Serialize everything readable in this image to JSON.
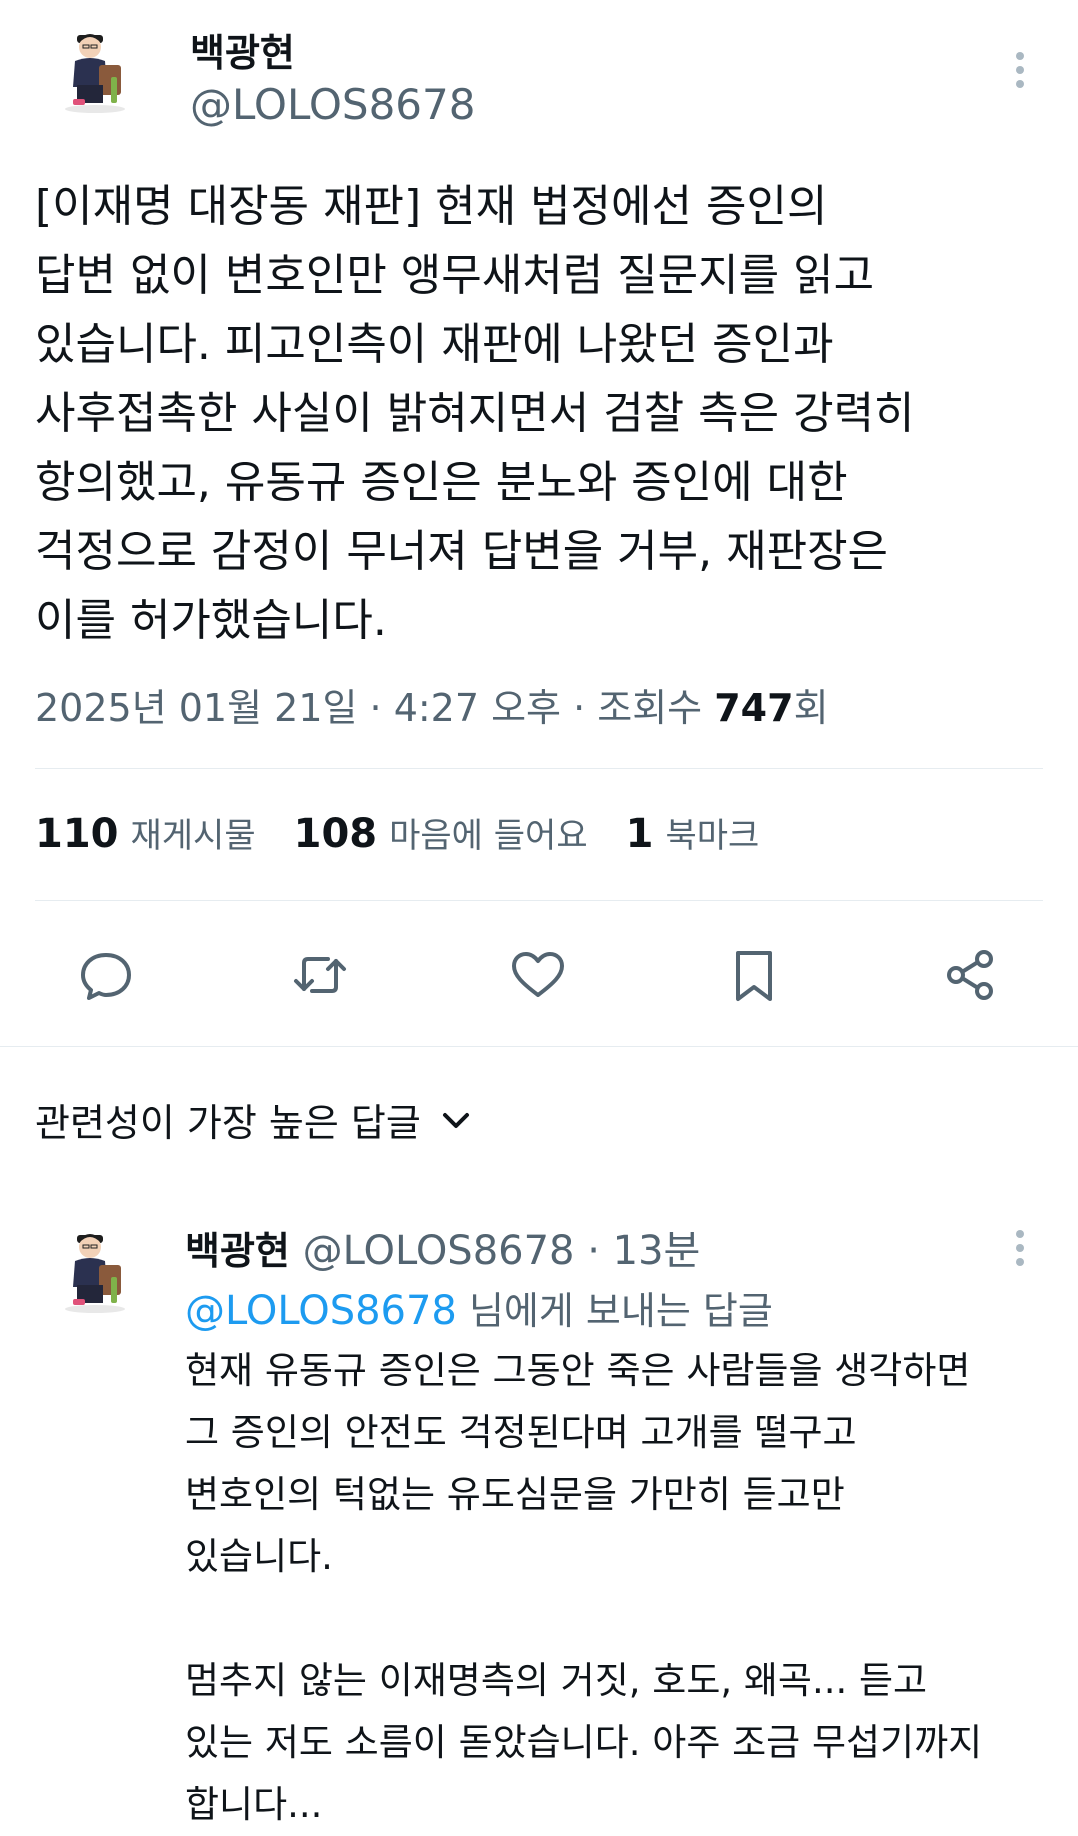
{
  "tweet": {
    "author_name": "백광현",
    "author_handle": "@LOLOS8678",
    "text_lines": [
      "[이재명 대장동 재판] 현재 법정에선 증인의",
      "답변 없이 변호인만 앵무새처럼 질문지를 읽고",
      "있습니다. 피고인측이 재판에 나왔던 증인과",
      "사후접촉한 사실이 밝혀지면서 검찰 측은 강력히",
      "항의했고, 유동규 증인은 분노와 증인에 대한",
      "걱정으로 감정이 무너져 답변을 거부, 재판장은",
      "이를 허가했습니다."
    ],
    "timestamp": "2025년 01월 21일 · 4:27 오후 · 조회수",
    "views_count": "747",
    "views_suffix": "회"
  },
  "stats": {
    "reposts_count": "110",
    "reposts_label": "재게시물",
    "likes_count": "108",
    "likes_label": "마음에 들어요",
    "bookmarks_count": "1",
    "bookmarks_label": "북마크"
  },
  "icons": {
    "reply": "reply-bubble-icon",
    "repost": "repost-arrows-icon",
    "like": "heart-icon",
    "bookmark": "bookmark-icon",
    "share": "share-icon",
    "more": "more-vertical-icon",
    "chevron": "chevron-down-icon"
  },
  "sort": {
    "label": "관련성이 가장 높은 답글"
  },
  "reply": {
    "author_name": "백광현",
    "author_handle": "@LOLOS8678",
    "time": "· 13분",
    "reply_to_mention": "@LOLOS8678",
    "reply_to_suffix": "님에게 보내는 답글",
    "text_lines": [
      "현재 유동규 증인은 그동안 죽은 사람들을 생각하면",
      "그 증인의 안전도 걱정된다며 고개를 떨구고",
      "변호인의 턱없는 유도심문을 가만히 듣고만",
      "있습니다.",
      "",
      "멈추지 않는 이재명측의 거짓, 호도, 왜곡... 듣고",
      "있는 저도 소름이 돋았습니다. 아주 조금 무섭기까지",
      "합니다..."
    ]
  },
  "colors": {
    "text": "#0f1419",
    "muted": "#536471",
    "link": "#1d9bf0",
    "divider": "#e6ecf0"
  }
}
